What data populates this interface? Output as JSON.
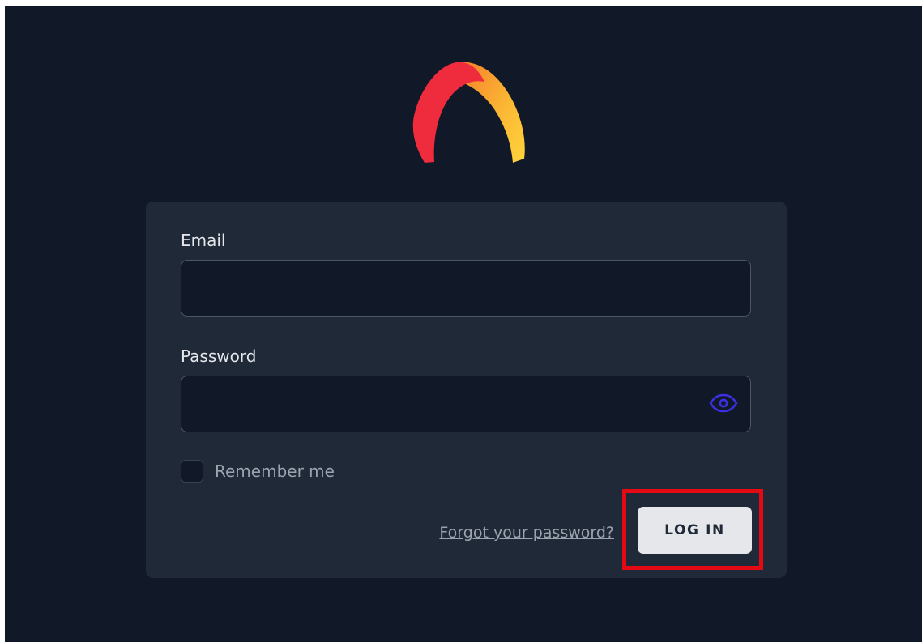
{
  "brand": {
    "logo_icon": "ember-arc-logo-icon",
    "colors": [
      "#ef2b3e",
      "#f7a630",
      "#ffd43b"
    ]
  },
  "form": {
    "email_label": "Email",
    "email_value": "",
    "password_label": "Password",
    "password_value": "",
    "password_toggle_icon": "eye-icon",
    "remember_label": "Remember me",
    "remember_checked": false,
    "forgot_link": "Forgot your password?",
    "login_label": "LOG IN"
  },
  "theme": {
    "page_background": "#111827",
    "card_background": "#1f2937",
    "accent": "#3b30e0",
    "highlight": "#e50914"
  }
}
